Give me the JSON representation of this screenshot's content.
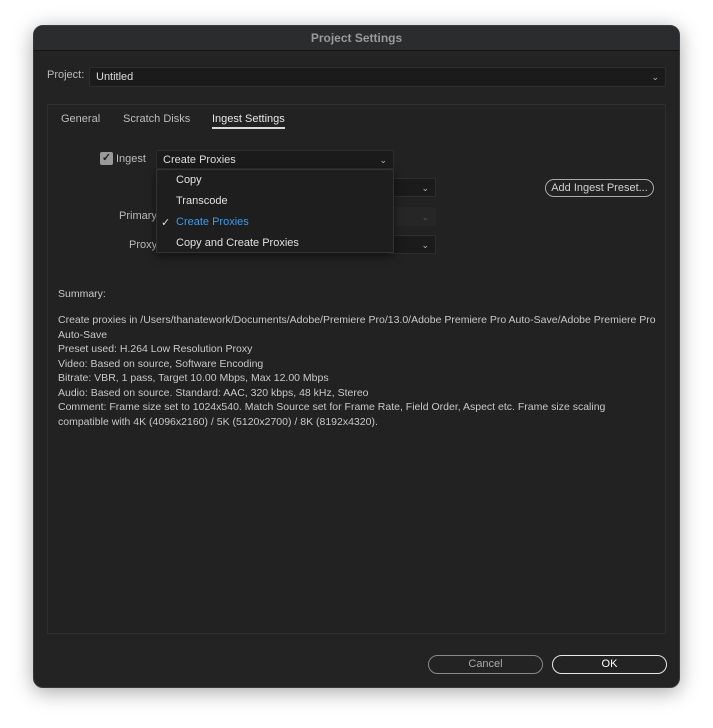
{
  "window": {
    "title": "Project Settings"
  },
  "project": {
    "label": "Project:",
    "value": "Untitled"
  },
  "tabs": [
    {
      "label": "General"
    },
    {
      "label": "Scratch Disks"
    },
    {
      "label": "Ingest Settings"
    }
  ],
  "ingest": {
    "checkbox_label": "Ingest",
    "checked": true,
    "selected": "Create Proxies",
    "options": [
      "Copy",
      "Transcode",
      "Create Proxies",
      "Copy and Create Proxies"
    ],
    "primary_label": "Primary",
    "proxy_label": "Proxy",
    "add_preset": "Add Ingest Preset..."
  },
  "summary": {
    "heading": "Summary:",
    "lines": [
      "Create proxies in /Users/thanatework/Documents/Adobe/Premiere Pro/13.0/Adobe Premiere Pro Auto-Save/Adobe Premiere Pro Auto-Save",
      "Preset used: H.264 Low Resolution Proxy",
      "Video: Based on source, Software Encoding",
      "Bitrate: VBR, 1 pass, Target 10.00 Mbps, Max 12.00 Mbps",
      "Audio: Based on source. Standard: AAC, 320 kbps, 48 kHz, Stereo",
      "Comment: Frame size set to 1024x540. Match Source set for Frame Rate, Field Order, Aspect etc. Frame size scaling compatible with 4K (4096x2160) / 5K (5120x2700) / 8K (8192x4320)."
    ]
  },
  "buttons": {
    "cancel": "Cancel",
    "ok": "OK"
  }
}
